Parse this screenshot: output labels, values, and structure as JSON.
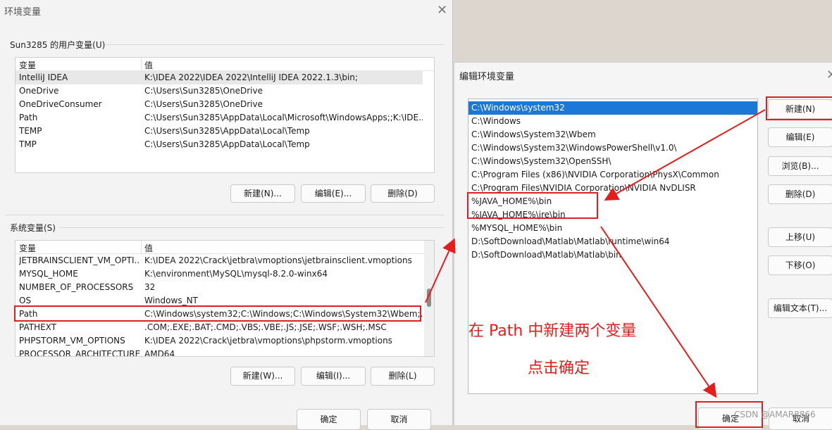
{
  "env_window": {
    "title": "环境变量",
    "user_group_label": "Sun3285 的用户变量(U)",
    "user_vars": {
      "headers": [
        "变量",
        "值"
      ],
      "rows": [
        [
          "IntelliJ IDEA",
          "K:\\IDEA 2022\\IDEA 2022\\IntelliJ IDEA 2022.1.3\\bin;"
        ],
        [
          "OneDrive",
          "C:\\Users\\Sun3285\\OneDrive"
        ],
        [
          "OneDriveConsumer",
          "C:\\Users\\Sun3285\\OneDrive"
        ],
        [
          "Path",
          "C:\\Users\\Sun3285\\AppData\\Local\\Microsoft\\WindowsApps;;K:\\IDE..."
        ],
        [
          "TEMP",
          "C:\\Users\\Sun3285\\AppData\\Local\\Temp"
        ],
        [
          "TMP",
          "C:\\Users\\Sun3285\\AppData\\Local\\Temp"
        ]
      ]
    },
    "user_buttons": {
      "new": "新建(N)...",
      "edit": "编辑(E)...",
      "delete": "删除(D)"
    },
    "sys_group_label": "系统变量(S)",
    "sys_vars": {
      "headers": [
        "变量",
        "值"
      ],
      "rows": [
        [
          "JETBRAINSCLIENT_VM_OPTI...",
          "K:\\IDEA 2022\\Crack\\jetbra\\vmoptions\\jetbrainsclient.vmoptions"
        ],
        [
          "MYSQL_HOME",
          "K:\\environment\\MySQL\\mysql-8.2.0-winx64"
        ],
        [
          "NUMBER_OF_PROCESSORS",
          "32"
        ],
        [
          "OS",
          "Windows_NT"
        ],
        [
          "Path",
          "C:\\Windows\\system32;C:\\Windows;C:\\Windows\\System32\\Wbem;..."
        ],
        [
          "PATHEXT",
          ".COM;.EXE;.BAT;.CMD;.VBS;.VBE;.JS;.JSE;.WSF;.WSH;.MSC"
        ],
        [
          "PHPSTORM_VM_OPTIONS",
          "K:\\IDEA 2022\\Crack\\jetbra\\vmoptions\\phpstorm.vmoptions"
        ],
        [
          "PROCESSOR_ARCHITECTURE",
          "AMD64"
        ]
      ]
    },
    "sys_buttons": {
      "new": "新建(W)...",
      "edit": "编辑(I)...",
      "delete": "删除(L)"
    },
    "ok": "确定",
    "cancel": "取消"
  },
  "edit_window": {
    "title": "编辑环境变量",
    "entries": [
      "C:\\Windows\\system32",
      "C:\\Windows",
      "C:\\Windows\\System32\\Wbem",
      "C:\\Windows\\System32\\WindowsPowerShell\\v1.0\\",
      "C:\\Windows\\System32\\OpenSSH\\",
      "C:\\Program Files (x86)\\NVIDIA Corporation\\PhysX\\Common",
      "C:\\Program Files\\NVIDIA Corporation\\NVIDIA NvDLISR",
      "%JAVA_HOME%\\bin",
      "%JAVA_HOME%\\jre\\bin",
      "%MYSQL_HOME%\\bin",
      "D:\\SoftDownload\\Matlab\\Matlab\\runtime\\win64",
      "D:\\SoftDownload\\Matlab\\Matlab\\bin"
    ],
    "selected_index": 0,
    "buttons": {
      "new": "新建(N)",
      "edit": "编辑(E)",
      "browse": "浏览(B)...",
      "delete": "删除(D)",
      "up": "上移(U)",
      "down": "下移(O)",
      "edit_text": "编辑文本(T)..."
    },
    "ok": "确定",
    "cancel": "取消"
  },
  "annotations": {
    "line1": "在 Path 中新建两个变量",
    "line2": "点击确定",
    "color": "#e41d1d"
  },
  "watermark": "CSDN @AMAR8866"
}
